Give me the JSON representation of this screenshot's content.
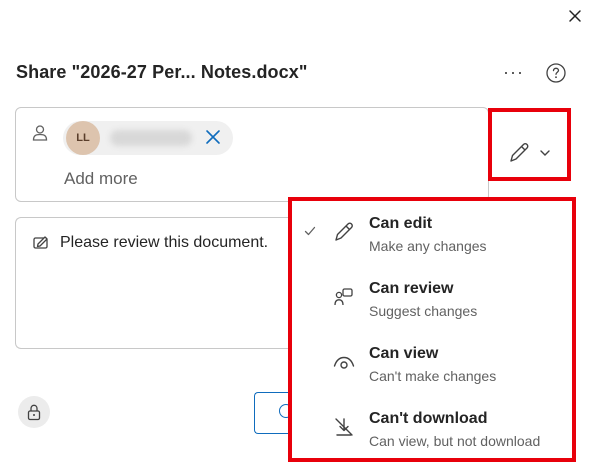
{
  "dialog": {
    "title": "Share \"2026-27 Per... Notes.docx\"",
    "more_label": "···",
    "close_icon": "close-icon",
    "help_icon": "question-circle-icon"
  },
  "recipients": {
    "chips": [
      {
        "initials": "LL",
        "name_blurred": true,
        "avatar_color": "#ddc4ae"
      }
    ],
    "add_more_placeholder": "Add more"
  },
  "permission_button": {
    "icon": "pencil-icon",
    "dropdown_icon": "chevron-down-icon"
  },
  "message": {
    "text": "Please review this document."
  },
  "permission_menu": {
    "items": [
      {
        "label": "Can edit",
        "description": "Make any changes",
        "icon": "pencil-icon",
        "selected": true
      },
      {
        "label": "Can review",
        "description": "Suggest changes",
        "icon": "review-icon",
        "selected": false
      },
      {
        "label": "Can view",
        "description": "Can't make changes",
        "icon": "eye-icon",
        "selected": false
      },
      {
        "label": "Can't download",
        "description": "Can view, but not download",
        "icon": "no-download-icon",
        "selected": false
      }
    ]
  },
  "footer": {
    "lock_icon": "lock-icon",
    "copy_link_icon": "link-icon"
  },
  "colors": {
    "highlight_border": "#e8000b",
    "accent": "#0f6cbd"
  }
}
